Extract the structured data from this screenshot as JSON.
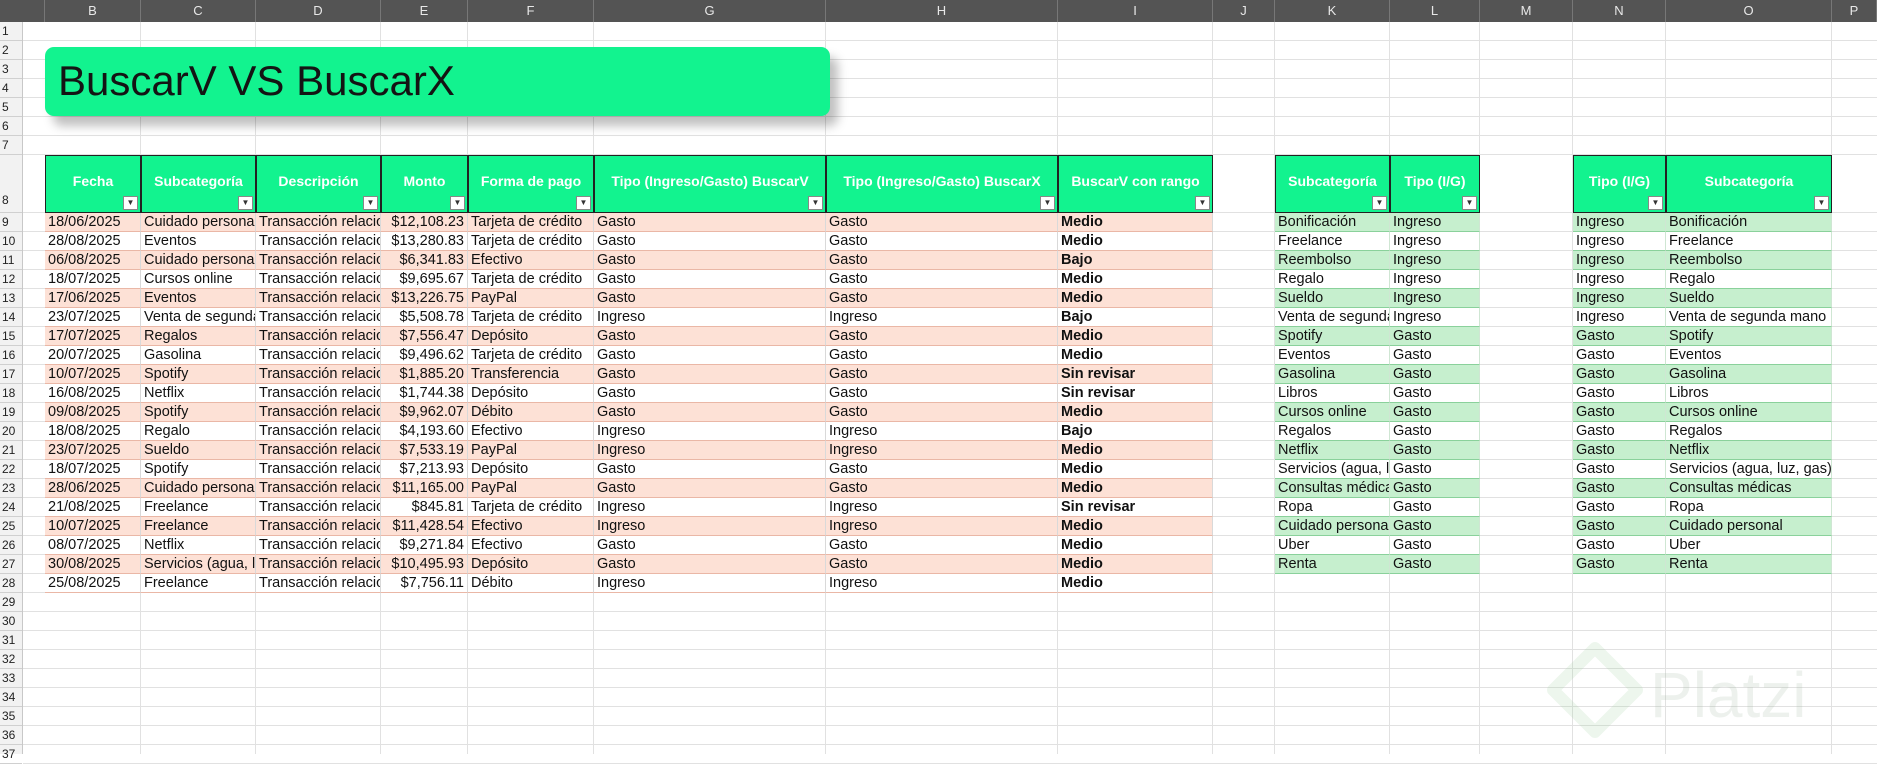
{
  "columns": [
    "B",
    "C",
    "D",
    "E",
    "F",
    "G",
    "H",
    "I",
    "J",
    "K",
    "L",
    "M",
    "N",
    "O",
    "P"
  ],
  "rows": [
    "1",
    "2",
    "3",
    "4",
    "5",
    "6",
    "7",
    "8",
    "9",
    "10",
    "11",
    "12",
    "13",
    "14",
    "15",
    "16",
    "17",
    "18",
    "19",
    "20",
    "21",
    "22",
    "23",
    "24",
    "25",
    "26",
    "27",
    "28",
    "29",
    "30",
    "31",
    "32",
    "33",
    "34",
    "35",
    "36",
    "37"
  ],
  "banner_title": "BuscarV VS BuscarX",
  "main_table": {
    "headers": [
      "Fecha",
      "Subcategoría",
      "Descripción",
      "Monto",
      "Forma de pago",
      "Tipo (Ingreso/Gasto) BuscarV",
      "Tipo (Ingreso/Gasto) BuscarX",
      "BuscarV con rango"
    ],
    "rows": [
      [
        "18/06/2025",
        "Cuidado personal",
        "Transacción relacionada",
        "$12,108.23",
        "Tarjeta de crédito",
        "Gasto",
        "Gasto",
        "Medio"
      ],
      [
        "28/08/2025",
        "Eventos",
        "Transacción relacionada",
        "$13,280.83",
        "Tarjeta de crédito",
        "Gasto",
        "Gasto",
        "Medio"
      ],
      [
        "06/08/2025",
        "Cuidado personal",
        "Transacción relacionada",
        "$6,341.83",
        "Efectivo",
        "Gasto",
        "Gasto",
        "Bajo"
      ],
      [
        "18/07/2025",
        "Cursos online",
        "Transacción relacionada",
        "$9,695.67",
        "Tarjeta de crédito",
        "Gasto",
        "Gasto",
        "Medio"
      ],
      [
        "17/06/2025",
        "Eventos",
        "Transacción relacionada",
        "$13,226.75",
        "PayPal",
        "Gasto",
        "Gasto",
        "Medio"
      ],
      [
        "23/07/2025",
        "Venta de segunda mano",
        "Transacción relacionada",
        "$5,508.78",
        "Tarjeta de crédito",
        "Ingreso",
        "Ingreso",
        "Bajo"
      ],
      [
        "17/07/2025",
        "Regalos",
        "Transacción relacionada",
        "$7,556.47",
        "Depósito",
        "Gasto",
        "Gasto",
        "Medio"
      ],
      [
        "20/07/2025",
        "Gasolina",
        "Transacción relacionada",
        "$9,496.62",
        "Tarjeta de crédito",
        "Gasto",
        "Gasto",
        "Medio"
      ],
      [
        "10/07/2025",
        "Spotify",
        "Transacción relacionada",
        "$1,885.20",
        "Transferencia",
        "Gasto",
        "Gasto",
        "Sin revisar"
      ],
      [
        "16/08/2025",
        "Netflix",
        "Transacción relacionada",
        "$1,744.38",
        "Depósito",
        "Gasto",
        "Gasto",
        "Sin revisar"
      ],
      [
        "09/08/2025",
        "Spotify",
        "Transacción relacionada",
        "$9,962.07",
        "Débito",
        "Gasto",
        "Gasto",
        "Medio"
      ],
      [
        "18/08/2025",
        "Regalo",
        "Transacción relacionada",
        "$4,193.60",
        "Efectivo",
        "Ingreso",
        "Ingreso",
        "Bajo"
      ],
      [
        "23/07/2025",
        "Sueldo",
        "Transacción relacionada",
        "$7,533.19",
        "PayPal",
        "Ingreso",
        "Ingreso",
        "Medio"
      ],
      [
        "18/07/2025",
        "Spotify",
        "Transacción relacionada",
        "$7,213.93",
        "Depósito",
        "Gasto",
        "Gasto",
        "Medio"
      ],
      [
        "28/06/2025",
        "Cuidado personal",
        "Transacción relacionada",
        "$11,165.00",
        "PayPal",
        "Gasto",
        "Gasto",
        "Medio"
      ],
      [
        "21/08/2025",
        "Freelance",
        "Transacción relacionada",
        "$845.81",
        "Tarjeta de crédito",
        "Ingreso",
        "Ingreso",
        "Sin revisar"
      ],
      [
        "10/07/2025",
        "Freelance",
        "Transacción relacionada",
        "$11,428.54",
        "Efectivo",
        "Ingreso",
        "Ingreso",
        "Medio"
      ],
      [
        "08/07/2025",
        "Netflix",
        "Transacción relacionada",
        "$9,271.84",
        "Efectivo",
        "Gasto",
        "Gasto",
        "Medio"
      ],
      [
        "30/08/2025",
        "Servicios (agua, luz, gas)",
        "Transacción relacionada",
        "$10,495.93",
        "Depósito",
        "Gasto",
        "Gasto",
        "Medio"
      ],
      [
        "25/08/2025",
        "Freelance",
        "Transacción relacionada",
        "$7,756.11",
        "Débito",
        "Ingreso",
        "Ingreso",
        "Medio"
      ]
    ]
  },
  "lookup_table_1": {
    "headers": [
      "Subcategoría",
      "Tipo (I/G)"
    ],
    "rows": [
      [
        "Bonificación",
        "Ingreso"
      ],
      [
        "Freelance",
        "Ingreso"
      ],
      [
        "Reembolso",
        "Ingreso"
      ],
      [
        "Regalo",
        "Ingreso"
      ],
      [
        "Sueldo",
        "Ingreso"
      ],
      [
        "Venta de segunda mano",
        "Ingreso"
      ],
      [
        "Spotify",
        "Gasto"
      ],
      [
        "Eventos",
        "Gasto"
      ],
      [
        "Gasolina",
        "Gasto"
      ],
      [
        "Libros",
        "Gasto"
      ],
      [
        "Cursos online",
        "Gasto"
      ],
      [
        "Regalos",
        "Gasto"
      ],
      [
        "Netflix",
        "Gasto"
      ],
      [
        "Servicios (agua, luz, gas)",
        "Gasto"
      ],
      [
        "Consultas médicas",
        "Gasto"
      ],
      [
        "Ropa",
        "Gasto"
      ],
      [
        "Cuidado personal",
        "Gasto"
      ],
      [
        "Uber",
        "Gasto"
      ],
      [
        "Renta",
        "Gasto"
      ]
    ]
  },
  "lookup_table_2": {
    "headers": [
      "Tipo (I/G)",
      "Subcategoría"
    ],
    "rows": [
      [
        "Ingreso",
        "Bonificación"
      ],
      [
        "Ingreso",
        "Freelance"
      ],
      [
        "Ingreso",
        "Reembolso"
      ],
      [
        "Ingreso",
        "Regalo"
      ],
      [
        "Ingreso",
        "Sueldo"
      ],
      [
        "Ingreso",
        "Venta de segunda mano"
      ],
      [
        "Gasto",
        "Spotify"
      ],
      [
        "Gasto",
        "Eventos"
      ],
      [
        "Gasto",
        "Gasolina"
      ],
      [
        "Gasto",
        "Libros"
      ],
      [
        "Gasto",
        "Cursos online"
      ],
      [
        "Gasto",
        "Regalos"
      ],
      [
        "Gasto",
        "Netflix"
      ],
      [
        "Gasto",
        "Servicios (agua, luz, gas)"
      ],
      [
        "Gasto",
        "Consultas médicas"
      ],
      [
        "Gasto",
        "Ropa"
      ],
      [
        "Gasto",
        "Cuidado personal"
      ],
      [
        "Gasto",
        "Uber"
      ],
      [
        "Gasto",
        "Renta"
      ]
    ]
  },
  "watermark": "Platzi",
  "colors": {
    "header_green": "#12f38f",
    "row_peach": "#fde1d6",
    "row_green": "#c6efce",
    "toolbar_gray": "#545454"
  }
}
